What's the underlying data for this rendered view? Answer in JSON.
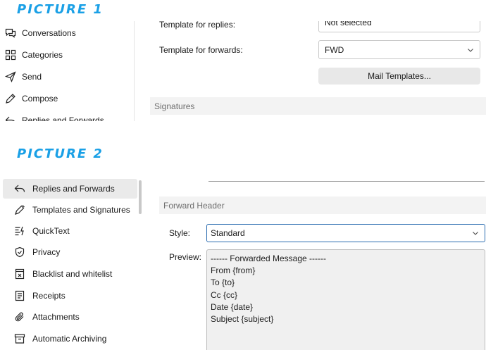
{
  "labels": {
    "picture1": "PICTURE 1",
    "picture2": "PICTURE 2"
  },
  "picture1": {
    "nav": [
      {
        "label": "Conversations",
        "icon": "conversations-icon"
      },
      {
        "label": "Categories",
        "icon": "categories-icon"
      },
      {
        "label": "Send",
        "icon": "send-icon"
      },
      {
        "label": "Compose",
        "icon": "compose-icon"
      },
      {
        "label": "Replies and Forwards",
        "icon": "reply-icon"
      }
    ],
    "template_replies": {
      "label": "Template for replies:",
      "value": "Not selected"
    },
    "template_forwards": {
      "label": "Template for forwards:",
      "value": "FWD"
    },
    "mail_templates_button": "Mail Templates...",
    "signatures_section": "Signatures"
  },
  "picture2": {
    "nav": [
      {
        "label": "Replies and Forwards",
        "icon": "reply-icon",
        "selected": true
      },
      {
        "label": "Templates and Signatures",
        "icon": "pen-icon"
      },
      {
        "label": "QuickText",
        "icon": "quicktext-icon"
      },
      {
        "label": "Privacy",
        "icon": "shield-icon"
      },
      {
        "label": "Blacklist and whitelist",
        "icon": "blacklist-icon"
      },
      {
        "label": "Receipts",
        "icon": "receipt-icon"
      },
      {
        "label": "Attachments",
        "icon": "paperclip-icon"
      },
      {
        "label": "Automatic Archiving",
        "icon": "archive-icon"
      }
    ],
    "forward_header_section": "Forward Header",
    "style": {
      "label": "Style:",
      "value": "Standard"
    },
    "preview": {
      "label": "Preview:",
      "lines": [
        "------ Forwarded Message ------",
        "From {from}",
        "To {to}",
        "Cc {cc}",
        "Date {date}",
        "Subject {subject}"
      ]
    }
  },
  "colors": {
    "label_blue": "#1aa0e6",
    "focus_border": "#2b6cb0",
    "section_bg": "#f3f3f3"
  }
}
